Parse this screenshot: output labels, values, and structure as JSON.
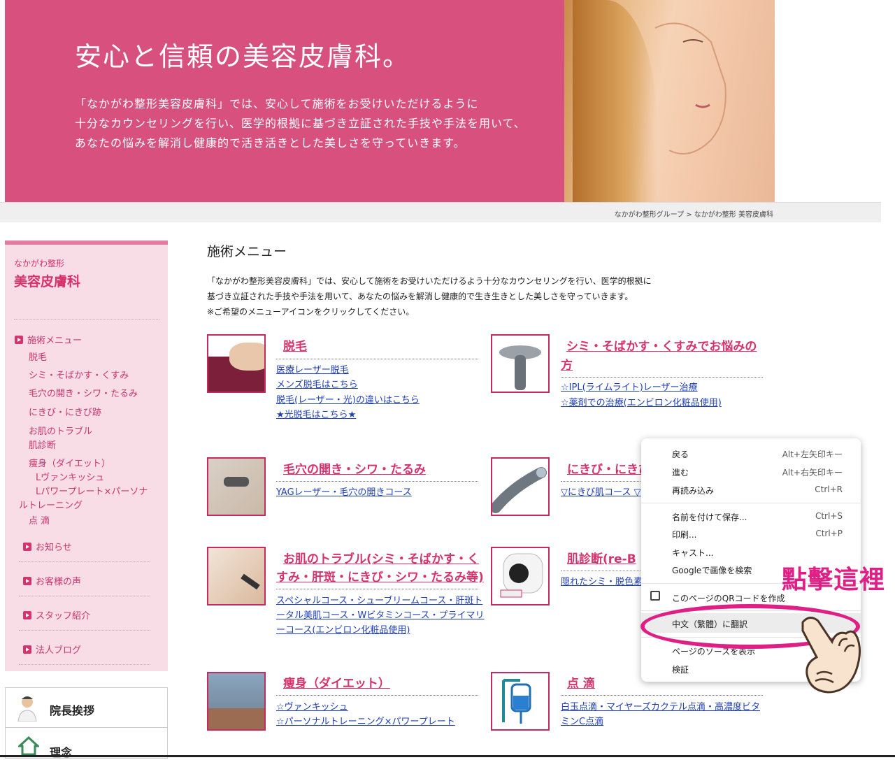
{
  "hero": {
    "title": "安心と信頼の美容皮膚科。",
    "lines": [
      "「なかがわ整形美容皮膚科」では、安心して施術をお受けいただけるように",
      "十分なカウンセリングを行い、医学的根拠に基づき立証された手技や手法を用いて、",
      "あなたの悩みを解消し健康的で活き活きとした美しさを守っていきます。"
    ]
  },
  "breadcrumb": "なかがわ整形グループ > なかがわ整形 美容皮膚科",
  "sidebar": {
    "subtitle": "なかがわ整形",
    "title": "美容皮膚科",
    "menu_head": "施術メニュー",
    "items": [
      "脱毛",
      "シミ・そばかす・くすみ",
      "毛穴の開き・シワ・たるみ",
      "にきび・にきび跡",
      "お肌のトラブル",
      "肌診断",
      "痩身（ダイエット）",
      "Lヴァンキッシュ",
      "Lパワープレート×パーソナ",
      "ルトレーニング",
      "点 滴"
    ],
    "sections": [
      "お知らせ",
      "お客様の声",
      "スタッフ紹介",
      "法人ブログ"
    ],
    "cards": [
      "院長挨拶",
      "理念"
    ]
  },
  "main": {
    "title": "施術メニュー",
    "intro": [
      "「なかがわ整形美容皮膚科」では、安心して施術をお受けいただけるよう十分なカウンセリングを行い、医学的根拠に",
      "基づき立証された手技や手法を用いて、あなたの悩みを解消し健康的で生き生きとした美しさを守っていきます。",
      "※ご希望のメニューアイコンをクリックしてください。"
    ],
    "menus": [
      {
        "title": "脱毛",
        "links": [
          "医療レーザー脱毛",
          "メンズ脱毛はこちら",
          "脱毛(レーザー・光)の違いはこちら",
          "★光脱毛はこちら★"
        ]
      },
      {
        "title": "シミ・そばかす・くすみでお悩みの方",
        "title_lines": [
          "シミ・そばかす・くすみでお悩みの",
          "方"
        ],
        "links": [
          "☆IPL(ライムライト)レーザー治療",
          "☆薬剤での治療(エンビロン化粧品使用)"
        ]
      },
      {
        "title": "毛穴の開き・シワ・たるみ",
        "links": [
          "YAGレーザー・毛穴の開きコース"
        ]
      },
      {
        "title": "にきび・にきび",
        "links": [
          "▽にきび肌コース ▽"
        ]
      },
      {
        "title": "お肌のトラブル(シミ・そばかす・くすみ・肝斑・にきび・シワ・たるみ等)",
        "title_lines": [
          "お肌のトラブル(シミ・そばかす・く",
          "すみ・肝斑・にきび・シワ・たるみ等)"
        ],
        "links": [
          "スペシャルコース・シューブリームコース・肝斑ト",
          "ータル美肌コース・Wビタミンコース・プライマリ",
          "ーコース(エンビロン化粧品使用)"
        ]
      },
      {
        "title": "肌診断(re-B",
        "links": [
          "隠れたシミ・脱色素"
        ]
      },
      {
        "title": "痩身（ダイエット）",
        "links": [
          "☆ヴァンキッシュ",
          "☆パーソナルトレーニング×パワープレート"
        ]
      },
      {
        "title": "点 滴",
        "links": [
          "白玉点滴・マイヤーズカクテル点滴・高濃度ビタ",
          "ミンC点滴"
        ]
      }
    ]
  },
  "context_menu": {
    "items": [
      {
        "label": "戻る",
        "key": "Alt+左矢印キー"
      },
      {
        "label": "進む",
        "key": "Alt+右矢印キー"
      },
      {
        "label": "再読み込み",
        "key": "Ctrl+R"
      },
      {
        "label": "名前を付けて保存...",
        "key": "Ctrl+S"
      },
      {
        "label": "印刷...",
        "key": "Ctrl+P"
      },
      {
        "label": "キャスト...",
        "key": ""
      },
      {
        "label": "Googleで画像を検索",
        "key": ""
      },
      {
        "label": "このページのQRコードを作成",
        "key": ""
      },
      {
        "label": "中文（繁體）に翻訳",
        "key": ""
      },
      {
        "label": "ページのソースを表示",
        "key": ""
      },
      {
        "label": "検証",
        "key": ""
      }
    ]
  },
  "annotation": {
    "callout": "點擊這裡",
    "accent": "#e01f86"
  },
  "colors": {
    "hero_bg": "#d8507e",
    "brand_pink": "#d6336c",
    "link_blue": "#1f3fb8",
    "sidebar_bg": "#f8dce6"
  }
}
